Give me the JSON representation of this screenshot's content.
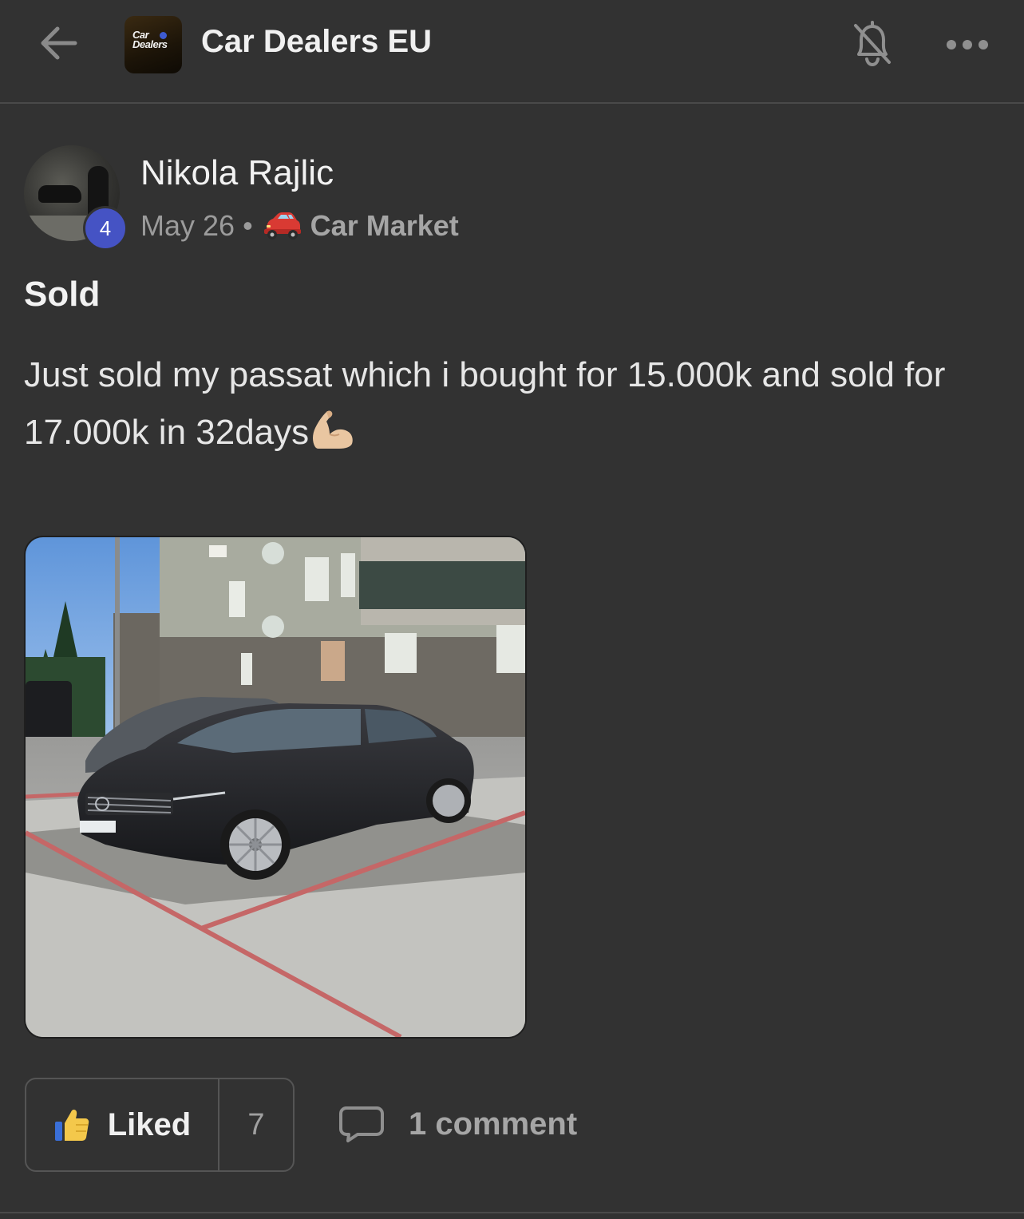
{
  "header": {
    "group_logo_text_line1": "Car",
    "group_logo_text_line2": "Dealers",
    "group_name": "Car Dealers EU"
  },
  "post": {
    "author": {
      "name": "Nikola Rajlic",
      "level": "4"
    },
    "date": "May 26",
    "separator": "•",
    "category": "Car Market",
    "title": "Sold",
    "body": "Just sold my passat which i bought for 15.000k and sold for 17.000k in 32days"
  },
  "actions": {
    "like_label": "Liked",
    "like_count": "7",
    "comment_label": "1 comment"
  },
  "colors": {
    "background": "#323232",
    "badge": "#4553c4",
    "muted_text": "#9b9b9b"
  },
  "icons": [
    "back-arrow-icon",
    "bell-muted-icon",
    "more-dots-icon",
    "red-car-emoji",
    "flexed-biceps-emoji",
    "thumbs-up-icon",
    "comment-bubble-icon"
  ]
}
